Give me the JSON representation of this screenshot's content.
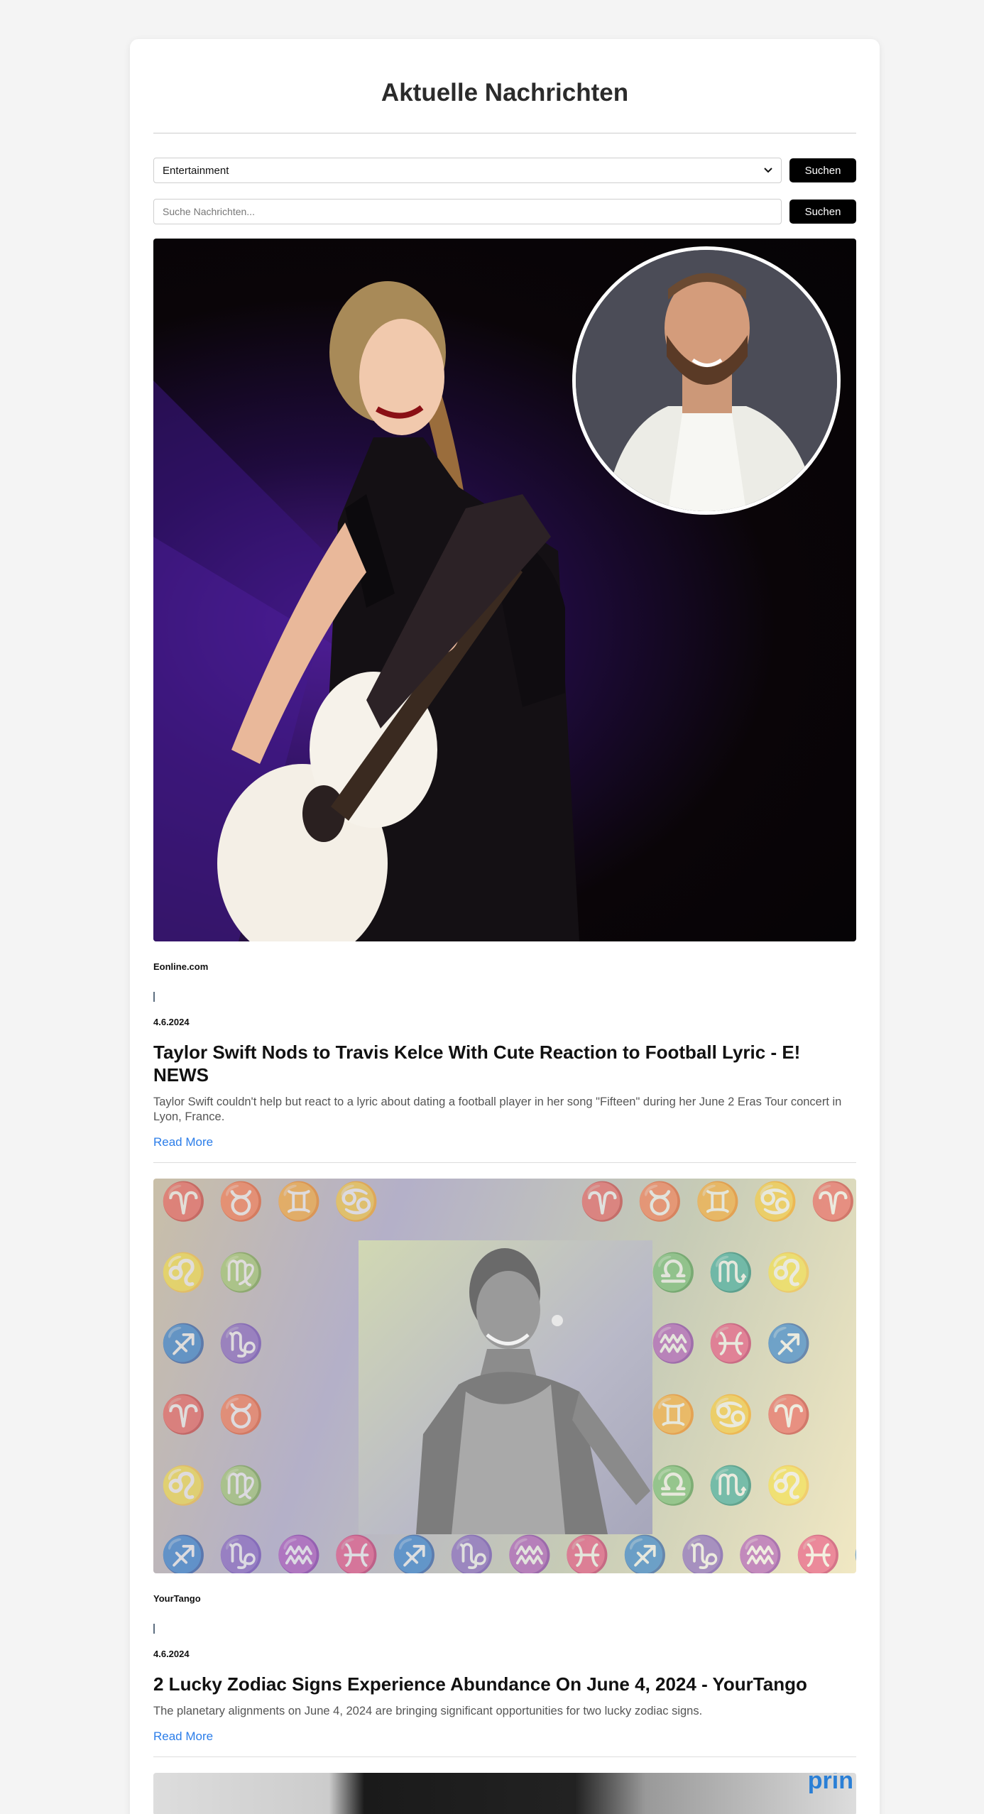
{
  "page_title": "Aktuelle Nachrichten",
  "filter": {
    "category_selected": "Entertainment",
    "category_button": "Suchen",
    "search_placeholder": "Suche Nachrichten...",
    "search_button": "Suchen"
  },
  "articles": [
    {
      "source": "Eonline.com",
      "separator": "|",
      "date": "4.6.2024",
      "title": "Taylor Swift Nods to Travis Kelce With Cute Reaction to Football Lyric - E! NEWS",
      "description": "Taylor Swift couldn't help but react to a lyric about dating a football player in her song \"Fifteen\" during her June 2 Eras Tour concert in Lyon, France.",
      "read_more": "Read More"
    },
    {
      "source": "YourTango",
      "separator": "|",
      "date": "4.6.2024",
      "title": "2 Lucky Zodiac Signs Experience Abundance On June 4, 2024 - YourTango",
      "description": "The planetary alignments on June 4, 2024 are bringing significant opportunities for two lucky zodiac signs.",
      "read_more": "Read More"
    }
  ],
  "partial_third_image_text": "prin",
  "colors": {
    "button_bg": "#000000",
    "link": "#2b7de9",
    "page_bg": "#f4f4f4"
  }
}
